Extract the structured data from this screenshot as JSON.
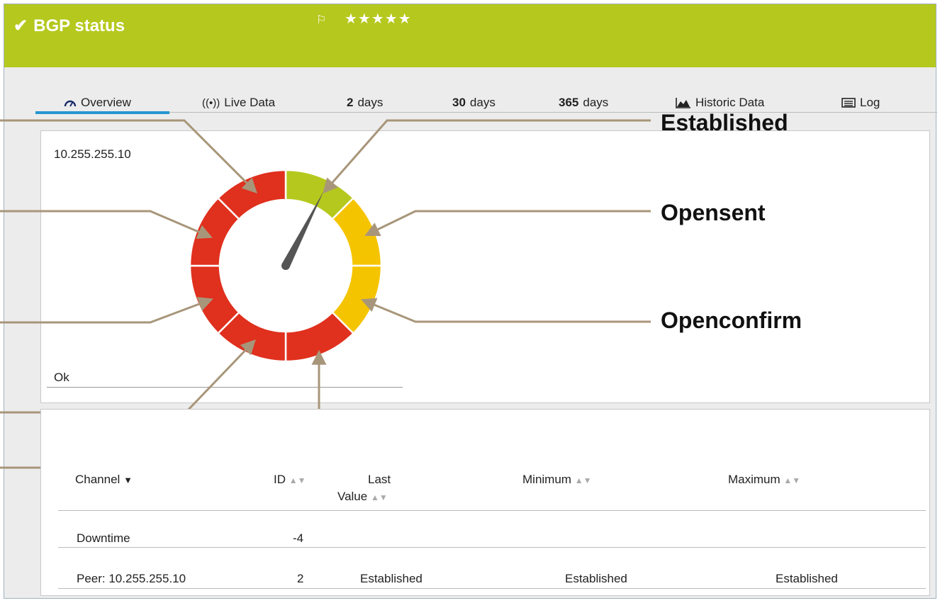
{
  "header": {
    "title": "BGP status",
    "stars": "★★★★★",
    "background": "#b5c81d"
  },
  "tabs": [
    {
      "label": "Overview",
      "icon": "gauge-icon"
    },
    {
      "label": "Live Data",
      "icon": "live-icon"
    },
    {
      "number": "2",
      "unit": "days"
    },
    {
      "number": "30",
      "unit": "days"
    },
    {
      "number": "365",
      "unit": "days"
    },
    {
      "label": "Historic Data",
      "icon": "chart-icon"
    },
    {
      "label": "Log",
      "icon": "log-icon"
    }
  ],
  "gauge": {
    "ip": "10.255.255.10",
    "status": "Ok",
    "needle_segment": 0,
    "segments": [
      {
        "state": "Established",
        "color": "#b5c81d"
      },
      {
        "state": "Opensent",
        "color": "#f5c400"
      },
      {
        "state": "Openconfirm",
        "color": "#f5c400"
      },
      {
        "state": "",
        "color": "#e0301e"
      },
      {
        "state": "",
        "color": "#e0301e"
      },
      {
        "state": "",
        "color": "#e0301e"
      },
      {
        "state": "",
        "color": "#e0301e"
      },
      {
        "state": "",
        "color": "#e0301e"
      }
    ],
    "callouts": [
      "Established",
      "Opensent",
      "Openconfirm"
    ],
    "arrow_color": "#a8967a"
  },
  "table": {
    "headers": {
      "channel": "Channel",
      "id": "ID",
      "last_a": "Last",
      "last_b": "Value",
      "minimum": "Minimum",
      "maximum": "Maximum"
    },
    "rows": [
      {
        "channel": "Downtime",
        "id": "-4",
        "last": "",
        "min": "",
        "max": ""
      },
      {
        "channel": "Peer: 10.255.255.10",
        "id": "2",
        "last": "Established",
        "min": "Established",
        "max": "Established"
      }
    ]
  }
}
